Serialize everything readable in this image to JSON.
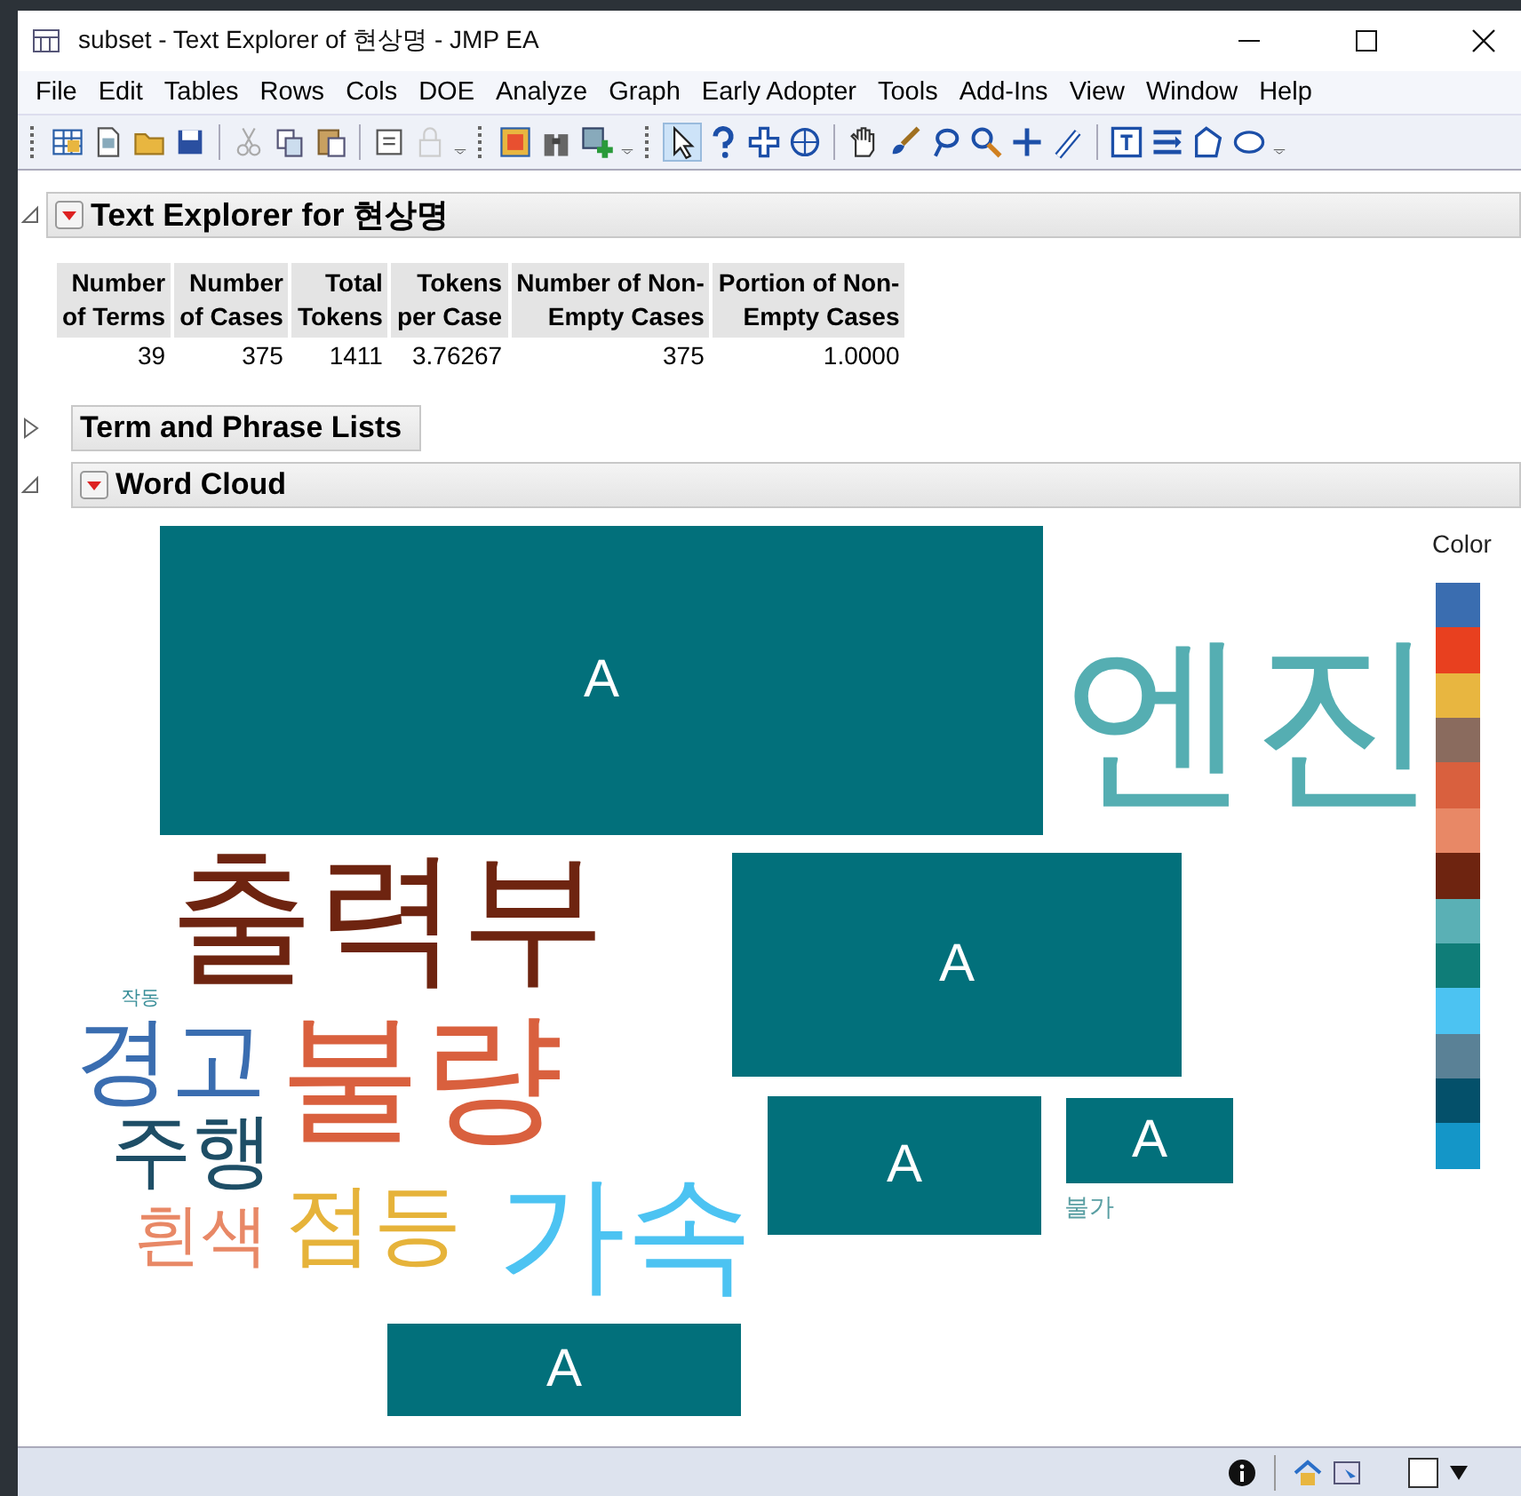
{
  "window": {
    "title": "subset - Text Explorer of 현상명 - JMP EA"
  },
  "menu": [
    "File",
    "Edit",
    "Tables",
    "Rows",
    "Cols",
    "DOE",
    "Analyze",
    "Graph",
    "Early Adopter",
    "Tools",
    "Add-Ins",
    "View",
    "Window",
    "Help"
  ],
  "report": {
    "title": "Text Explorer for 현상명",
    "expanded": true
  },
  "summary": {
    "columns": [
      "Number\nof Terms",
      "Number\nof Cases",
      "Total\nTokens",
      "Tokens\nper Case",
      "Number of Non-\nEmpty Cases",
      "Portion of Non-\nEmpty Cases"
    ],
    "values": [
      "39",
      "375",
      "1411",
      "3.76267",
      "375",
      "1.0000"
    ]
  },
  "sections": [
    {
      "title": "Term and Phrase Lists",
      "expanded": false,
      "menu": false
    },
    {
      "title": "Word Cloud",
      "expanded": true,
      "menu": true
    }
  ],
  "word_cloud": {
    "items": [
      {
        "kind": "block",
        "text": "A"
      },
      {
        "kind": "word",
        "text": "엔진",
        "color": "#55aeb2"
      },
      {
        "kind": "word",
        "text": "출력부",
        "color": "#6e2410"
      },
      {
        "kind": "block",
        "text": "A"
      },
      {
        "kind": "word",
        "text": "작동",
        "color": "#3a8f99"
      },
      {
        "kind": "word",
        "text": "경고",
        "color": "#3a6db0"
      },
      {
        "kind": "word",
        "text": "불량",
        "color": "#d9603e"
      },
      {
        "kind": "word",
        "text": "주행",
        "color": "#1e4e66"
      },
      {
        "kind": "word",
        "text": "흰색",
        "color": "#e88866"
      },
      {
        "kind": "word",
        "text": "점등",
        "color": "#e6b33a"
      },
      {
        "kind": "word",
        "text": "가속",
        "color": "#4cc3f2"
      },
      {
        "kind": "block",
        "text": "A"
      },
      {
        "kind": "block",
        "text": "A"
      },
      {
        "kind": "word",
        "text": "불가",
        "color": "#5a9fa3"
      },
      {
        "kind": "block",
        "text": "A"
      }
    ],
    "legend": {
      "title": "Color",
      "swatches": [
        {
          "color": "#3a6db0"
        },
        {
          "color": "#e8401f"
        },
        {
          "color": "#e8b640"
        },
        {
          "color": "#8a6b5e"
        },
        {
          "color": "#d9603e"
        },
        {
          "color": "#e88866"
        },
        {
          "color": "#6e2410"
        },
        {
          "color": "#5ab0b5"
        },
        {
          "color": "#0f7d78"
        },
        {
          "color": "#4cc3f2"
        },
        {
          "color": "#5a8196"
        },
        {
          "color": "#04506a"
        },
        {
          "color": "#1496c8"
        }
      ]
    }
  }
}
